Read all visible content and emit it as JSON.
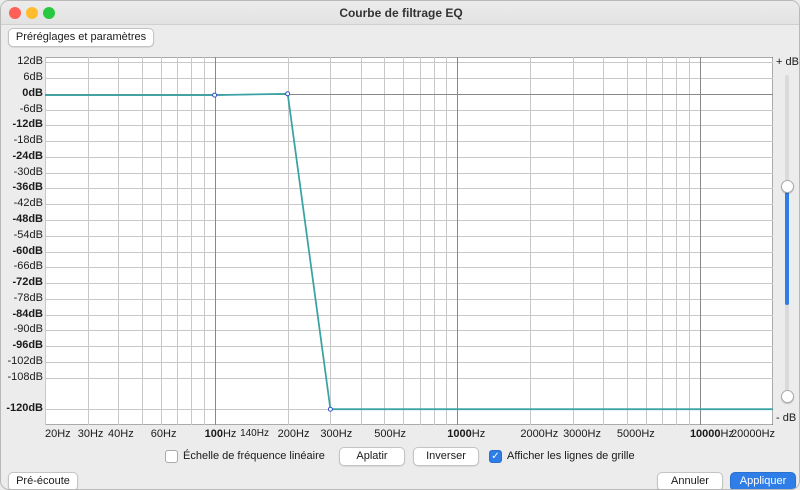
{
  "window": {
    "title": "Courbe de filtrage EQ"
  },
  "toolbar": {
    "presets_label": "Préréglages et paramètres"
  },
  "graph": {
    "db_ticks": [
      "12dB",
      "6dB",
      "0dB",
      "-6dB",
      "-12dB",
      "-18dB",
      "-24dB",
      "-30dB",
      "-36dB",
      "-42dB",
      "-48dB",
      "-54dB",
      "-60dB",
      "-66dB",
      "-72dB",
      "-78dB",
      "-84dB",
      "-90dB",
      "-96dB",
      "-102dB",
      "-108dB",
      "-120dB"
    ],
    "freq_ticks": [
      "20Hz",
      "30Hz",
      "40Hz",
      "60Hz",
      "100Hz",
      "140Hz",
      "200Hz",
      "300Hz",
      "500Hz",
      "1000Hz",
      "2000Hz",
      "3000Hz",
      "5000Hz",
      "10000Hz",
      "20000Hz"
    ],
    "slider_top_label": "+ dB",
    "slider_bottom_label": "- dB",
    "curve_color": "#3aa8a0",
    "handle_line_color": "#3050c8",
    "grid_visible": true
  },
  "chart_data": {
    "type": "line",
    "xlabel": "",
    "ylabel": "",
    "x_scale": "log",
    "xlim": [
      20,
      20000
    ],
    "ylim": [
      -126,
      14
    ],
    "series": [
      {
        "x": [
          20,
          100,
          200,
          300,
          20000
        ],
        "y": [
          -0.5,
          -0.5,
          0,
          -120,
          -120
        ]
      }
    ]
  },
  "options": {
    "linear_scale_label": "Échelle de fréquence linéaire",
    "linear_scale_checked": false,
    "flatten_label": "Aplatir",
    "invert_label": "Inverser",
    "grid_lines_label": "Afficher les lignes de grille",
    "grid_lines_checked": true
  },
  "footer": {
    "preview_label": "Pré-écoute",
    "cancel_label": "Annuler",
    "apply_label": "Appliquer"
  }
}
